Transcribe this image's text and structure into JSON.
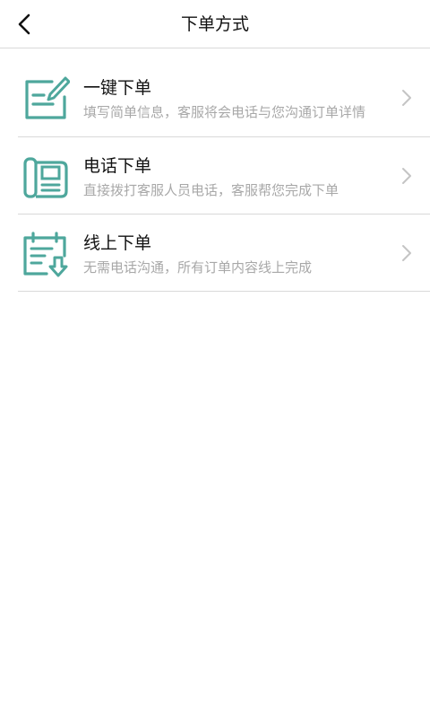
{
  "header": {
    "title": "下单方式"
  },
  "options": [
    {
      "icon": "edit-form-icon",
      "title": "一键下单",
      "description": "填写简单信息，客服将会电话与您沟通订单详情"
    },
    {
      "icon": "telephone-icon",
      "title": "电话下单",
      "description": "直接拨打客服人员电话，客服帮您完成下单"
    },
    {
      "icon": "document-download-icon",
      "title": "线上下单",
      "description": "无需电话沟通，所有订单内容线上完成"
    }
  ],
  "colors": {
    "accent": "#4ea79c",
    "title_text": "#111111",
    "secondary_text": "#a8a8a8",
    "divider": "#d9d9d9",
    "chevron": "#c4c4c4"
  }
}
